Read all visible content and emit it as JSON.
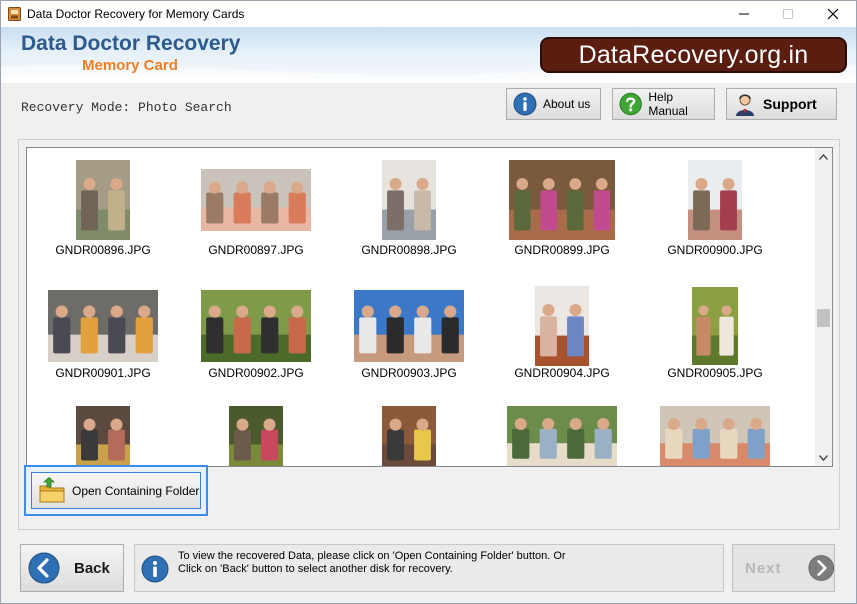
{
  "window": {
    "title": "Data Doctor Recovery for Memory Cards",
    "controls": [
      "minimize",
      "maximize",
      "close"
    ]
  },
  "header": {
    "brand_main": "Data Doctor Recovery",
    "brand_sub": "Memory Card",
    "logo_text": "DataRecovery.org.in",
    "logo_bg": "#5a1d0f"
  },
  "mode": {
    "text": "Recovery Mode: Photo Search"
  },
  "top_buttons": {
    "about": "About us",
    "help": "Help Manual",
    "support": "Support"
  },
  "gallery": {
    "items": [
      {
        "name": "GNDR00896.JPG",
        "palette": [
          "#a59c85",
          "#7f8b69",
          "#c2b08b",
          "#6f6456"
        ]
      },
      {
        "name": "GNDR00897.JPG",
        "palette": [
          "#c9c3bc",
          "#e7b7a4",
          "#d87c5b",
          "#9b7b66"
        ]
      },
      {
        "name": "GNDR00898.JPG",
        "palette": [
          "#e6e3df",
          "#9aa0a8",
          "#c8b9a9",
          "#7c6e69"
        ]
      },
      {
        "name": "GNDR00899.JPG",
        "palette": [
          "#7a5a3d",
          "#a86c4a",
          "#c24a8f",
          "#5a6a3a"
        ]
      },
      {
        "name": "GNDR00900.JPG",
        "palette": [
          "#e9edf0",
          "#c58f80",
          "#a43e4f",
          "#7d6a56"
        ]
      },
      {
        "name": "GNDR00901.JPG",
        "palette": [
          "#6e6c68",
          "#d7d0c8",
          "#e2a13c",
          "#4a4a52"
        ]
      },
      {
        "name": "GNDR00902.JPG",
        "palette": [
          "#7f9b4a",
          "#4c6b2a",
          "#c76a4a",
          "#2f2f2f"
        ]
      },
      {
        "name": "GNDR00903.JPG",
        "palette": [
          "#3b78c8",
          "#c69a7c",
          "#2b2b2b",
          "#e8e8e8"
        ]
      },
      {
        "name": "GNDR00904.JPG",
        "palette": [
          "#ece7e2",
          "#a9532e",
          "#6e86c2",
          "#d9b3a0"
        ]
      },
      {
        "name": "GNDR00905.JPG",
        "palette": [
          "#8aa043",
          "#5d7a2c",
          "#eee7db",
          "#c68b66"
        ]
      },
      {
        "name": "",
        "palette": [
          "#5c4a40",
          "#c8a14a",
          "#b56b5a",
          "#3a3a3a"
        ]
      },
      {
        "name": "",
        "palette": [
          "#4a5a2c",
          "#7a8a3a",
          "#c8485e",
          "#6c5a4a"
        ]
      },
      {
        "name": "",
        "palette": [
          "#8a5a3a",
          "#6a4a3a",
          "#e8c84a",
          "#3a3a3a"
        ]
      },
      {
        "name": "",
        "palette": [
          "#6b8c4a",
          "#e6dcc8",
          "#9ab0c4",
          "#4a6a3a"
        ]
      },
      {
        "name": "",
        "palette": [
          "#cfc6b8",
          "#d98a6a",
          "#7fa0c8",
          "#e8d8c0"
        ]
      }
    ]
  },
  "actions": {
    "open_folder": "Open Containing Folder",
    "back": "Back",
    "next": "Next"
  },
  "info": {
    "line1": "To view the recovered Data, please click on 'Open Containing Folder' button. Or",
    "line2": "Click on 'Back' button to select another disk for recovery."
  },
  "colors": {
    "brand_blue": "#2d5a8c",
    "brand_orange": "#ef7d22",
    "selection_blue": "#3a8ee6"
  }
}
